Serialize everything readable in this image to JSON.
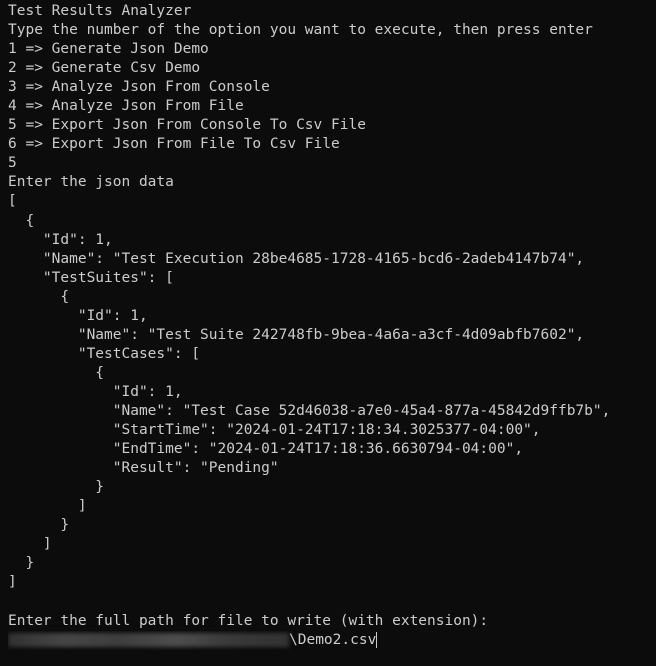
{
  "console": {
    "lines": [
      "Test Results Analyzer",
      "Type the number of the option you want to execute, then press enter",
      "1 => Generate Json Demo",
      "2 => Generate Csv Demo",
      "3 => Analyze Json From Console",
      "4 => Analyze Json From File",
      "5 => Export Json From Console To Csv File",
      "6 => Export Json From File To Csv File",
      "5",
      "Enter the json data",
      "[",
      "  {",
      "    \"Id\": 1,",
      "    \"Name\": \"Test Execution 28be4685-1728-4165-bcd6-2adeb4147b74\",",
      "    \"TestSuites\": [",
      "      {",
      "        \"Id\": 1,",
      "        \"Name\": \"Test Suite 242748fb-9bea-4a6a-a3cf-4d09abfb7602\",",
      "        \"TestCases\": [",
      "          {",
      "            \"Id\": 1,",
      "            \"Name\": \"Test Case 52d46038-a7e0-45a4-877a-45842d9ffb7b\",",
      "            \"StartTime\": \"2024-01-24T17:18:34.3025377-04:00\",",
      "            \"EndTime\": \"2024-01-24T17:18:36.6630794-04:00\",",
      "            \"Result\": \"Pending\"",
      "          }",
      "        ]",
      "      }",
      "    ]",
      "  }",
      "]",
      "",
      "Enter the full path for file to write (with extension):"
    ],
    "input_suffix": "\\Demo2.csv"
  },
  "colors": {
    "background": "#0c0c0c",
    "foreground": "#cccccc"
  }
}
